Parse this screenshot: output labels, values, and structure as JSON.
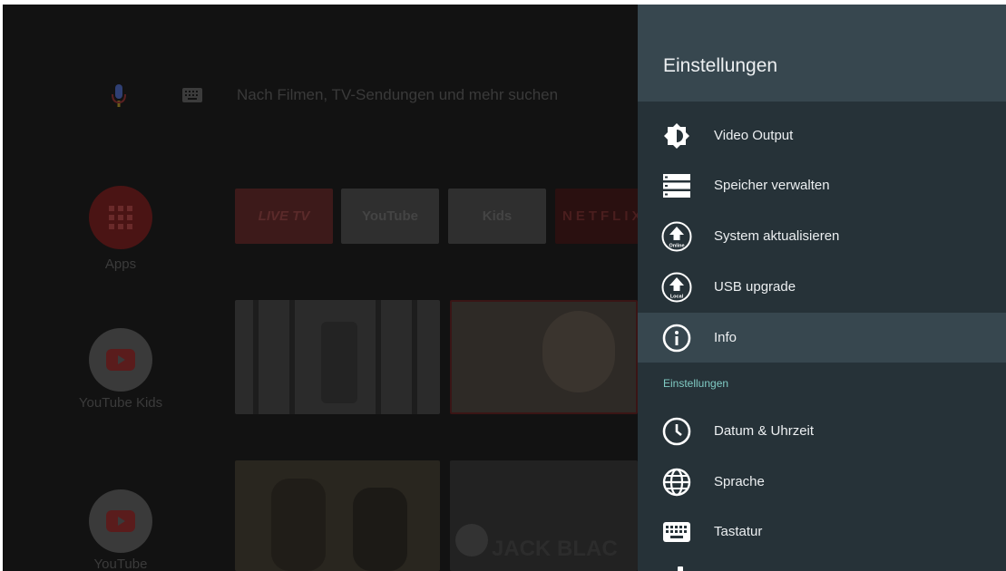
{
  "launcher": {
    "search_placeholder": "Nach Filmen, TV-Sendungen und mehr suchen",
    "apps": [
      {
        "label": "Apps"
      },
      {
        "label": "YouTube Kids"
      },
      {
        "label": "YouTube"
      }
    ],
    "channels": [
      "LIVE TV",
      "YouTube",
      "Kids",
      "NETFLIX"
    ],
    "video_tile_text": "JACK BLAC"
  },
  "settings": {
    "title": "Einstellungen",
    "items": [
      {
        "label": "Video Output",
        "icon": "brightness-icon"
      },
      {
        "label": "Speicher verwalten",
        "icon": "storage-icon"
      },
      {
        "label": "System aktualisieren",
        "icon": "online-update-icon",
        "badge": "Online"
      },
      {
        "label": "USB upgrade",
        "icon": "local-update-icon",
        "badge": "Local"
      },
      {
        "label": "Info",
        "icon": "info-icon",
        "selected": true
      }
    ],
    "section_header": "Einstellungen",
    "section_items": [
      {
        "label": "Datum & Uhrzeit",
        "icon": "clock-icon"
      },
      {
        "label": "Sprache",
        "icon": "globe-icon"
      },
      {
        "label": "Tastatur",
        "icon": "keyboard-icon"
      }
    ]
  },
  "colors": {
    "panel_bg": "#263238",
    "panel_header_bg": "#37474f",
    "selected_row_bg": "#37474f",
    "section_header": "#80cbc4",
    "launcher_dim_bg": "#121212"
  }
}
